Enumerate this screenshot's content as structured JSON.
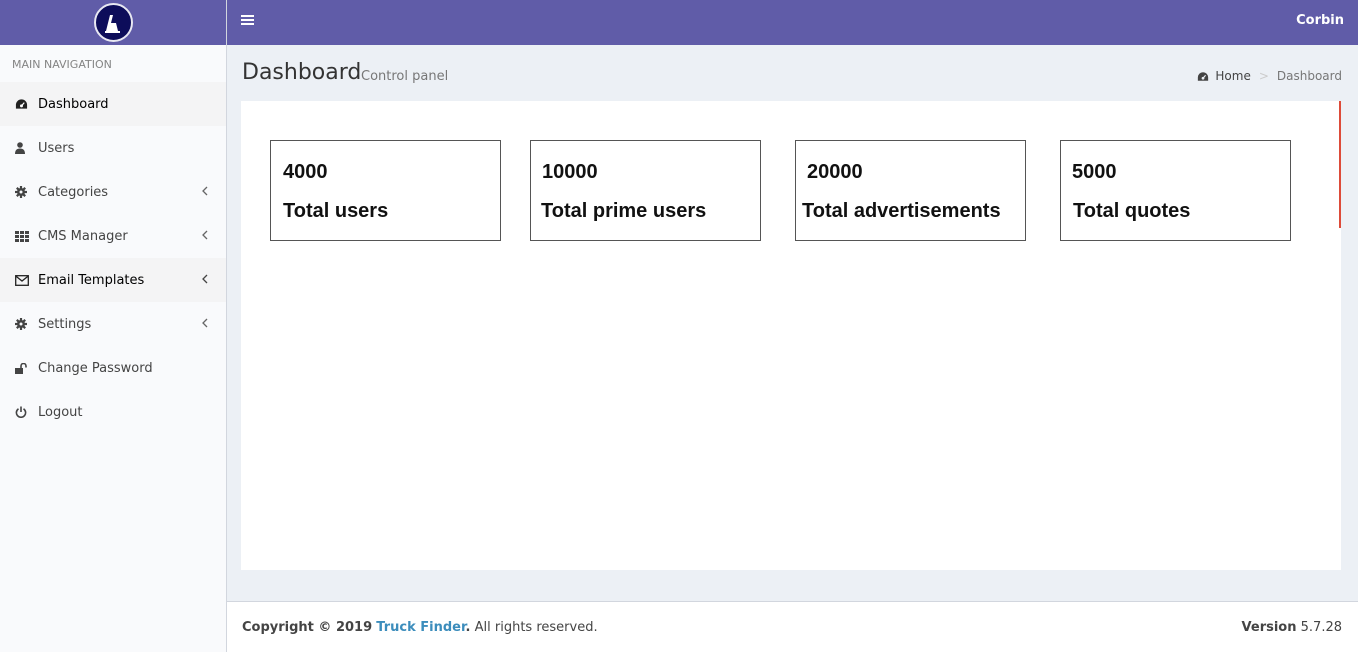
{
  "header": {
    "username": "Corbin"
  },
  "sidebar": {
    "section_header": "MAIN NAVIGATION",
    "items": [
      {
        "label": "Dashboard",
        "icon": "dashboard-icon"
      },
      {
        "label": "Users",
        "icon": "user-icon"
      },
      {
        "label": "Categories",
        "icon": "gear-icon"
      },
      {
        "label": "CMS Manager",
        "icon": "grid-icon"
      },
      {
        "label": "Email Templates",
        "icon": "envelope-icon"
      },
      {
        "label": "Settings",
        "icon": "gear-icon"
      },
      {
        "label": "Change Password",
        "icon": "unlock-icon"
      },
      {
        "label": "Logout",
        "icon": "power-icon"
      }
    ]
  },
  "page": {
    "title": "Dashboard",
    "subtitle": "Control panel",
    "breadcrumb": {
      "home": "Home",
      "current": "Dashboard"
    }
  },
  "stats": [
    {
      "value": "4000",
      "label": "Total users"
    },
    {
      "value": "10000",
      "label": "Total prime users"
    },
    {
      "value": "20000",
      "label": "Total advertisements"
    },
    {
      "value": "5000",
      "label": "Total quotes"
    }
  ],
  "footer": {
    "copyright_prefix": "Copyright © 2019",
    "brand": "Truck Finder",
    "brand_dot": ".",
    "rights": "All rights reserved.",
    "version_label": "Version",
    "version_number": "5.7.28"
  },
  "colors": {
    "header_bg": "#605ca8",
    "link": "#3c8dbc",
    "accent": "#dd4b39"
  }
}
